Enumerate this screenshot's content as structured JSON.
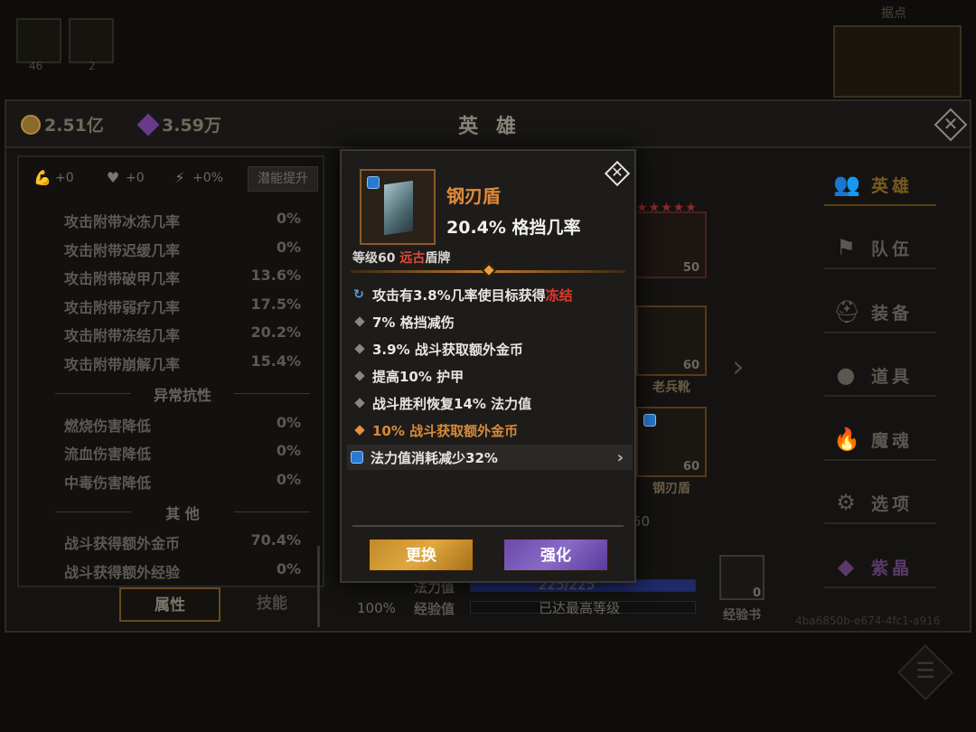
{
  "background": {
    "slots": [
      {
        "count": "46"
      },
      {
        "count": "2"
      }
    ],
    "map_label": "据点"
  },
  "header": {
    "gold": "2.51亿",
    "crystal": "3.59万",
    "title": "英 雄"
  },
  "attributes": {
    "mini_stats": {
      "power": "+0",
      "health": "+0",
      "energy": "+0%"
    },
    "potential_button": "潜能提升",
    "rows_top": [
      {
        "name": "攻击附带冰冻几率",
        "value": "0%"
      },
      {
        "name": "攻击附带迟缓几率",
        "value": "0%"
      },
      {
        "name": "攻击附带破甲几率",
        "value": "13.6%"
      },
      {
        "name": "攻击附带弱疗几率",
        "value": "17.5%"
      },
      {
        "name": "攻击附带冻结几率",
        "value": "20.2%"
      },
      {
        "name": "攻击附带崩解几率",
        "value": "15.4%"
      }
    ],
    "section_resist": "异常抗性",
    "rows_resist": [
      {
        "name": "燃烧伤害降低",
        "value": "0%"
      },
      {
        "name": "流血伤害降低",
        "value": "0%"
      },
      {
        "name": "中毒伤害降低",
        "value": "0%"
      }
    ],
    "section_other": "其 他",
    "rows_other": [
      {
        "name": "战斗获得额外金币",
        "value": "70.4%"
      },
      {
        "name": "战斗获得额外经验",
        "value": "0%"
      }
    ]
  },
  "tabs": {
    "attributes": "属性",
    "skills": "技能"
  },
  "hero_area": {
    "hero_level": "50",
    "boots_level": "60",
    "boots_name": "老兵靴",
    "shield_level": "60",
    "shield_name": "钢刃盾",
    "hidden_level": "50",
    "percent": "100%",
    "mana_label": "法力值",
    "mana_value": "225/225",
    "exp_label": "经验值",
    "exp_value": "已达最高等级",
    "mana_fill": 1.0,
    "exp_book_count": "0",
    "exp_book_label": "经验书"
  },
  "nav": {
    "items": [
      {
        "label": "英雄",
        "icon": "heroes-icon"
      },
      {
        "label": "队伍",
        "icon": "flag-icon"
      },
      {
        "label": "装备",
        "icon": "helmet-icon"
      },
      {
        "label": "道具",
        "icon": "bag-icon"
      },
      {
        "label": "魔魂",
        "icon": "flame-icon"
      },
      {
        "label": "选项",
        "icon": "gear-icon"
      },
      {
        "label": "紫晶",
        "icon": "crystal-icon"
      }
    ],
    "hero_id": "4ba6850b-e674-4fc1-a916"
  },
  "item_popup": {
    "name": "钢刃盾",
    "main_stat": "20.4% 格挡几率",
    "meta_level": "等级60",
    "meta_rarity": "远古",
    "meta_type": "盾牌",
    "affixes": {
      "refresh_prefix": "攻击有3.8%几率使目标获得",
      "refresh_effect": "冻结",
      "a1": "7% 格挡减伤",
      "a2": "3.9% 战斗获取额外金币",
      "a3": "提高10% 护甲",
      "a4": "战斗胜利恢复14% 法力值",
      "orange": "10% 战斗获取额外金币",
      "mana": "法力值消耗减少32%"
    },
    "btn_replace": "更换",
    "btn_enhance": "强化"
  },
  "colors": {
    "rarity_red": "#e04a3a",
    "item_orange": "#e08a3a",
    "btn_gold": "#e0a83e",
    "btn_purple": "#8a6ac8"
  }
}
